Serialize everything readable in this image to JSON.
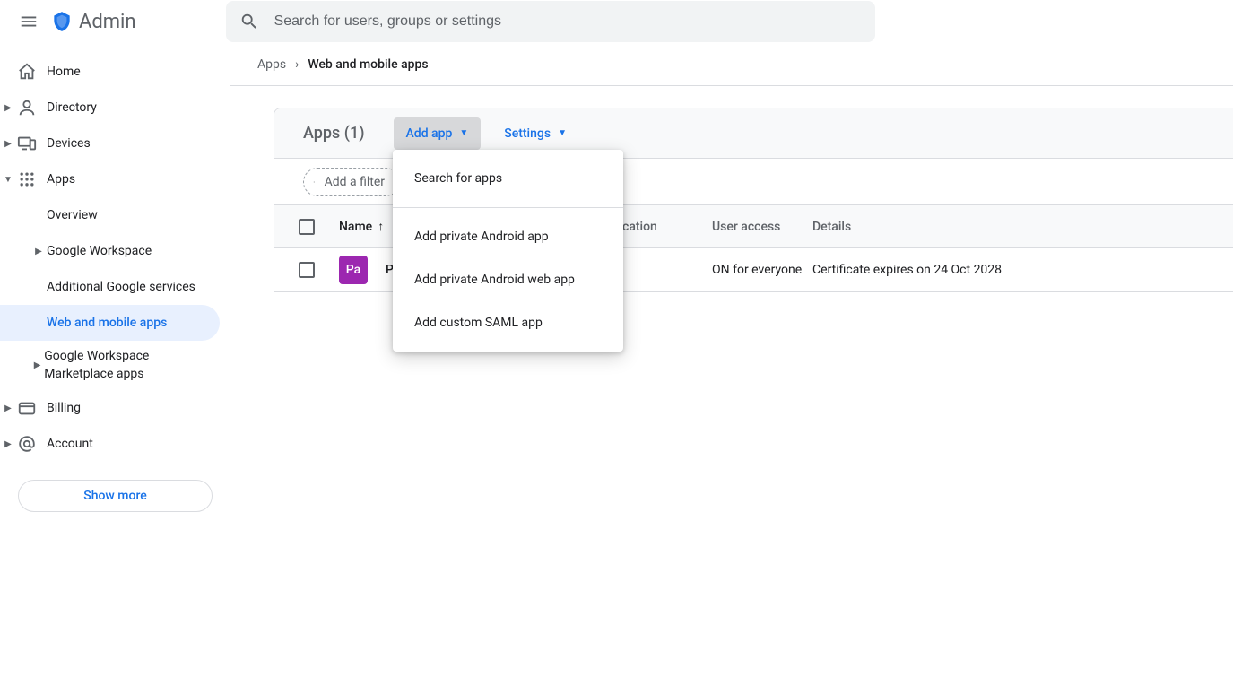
{
  "header": {
    "product": "Admin",
    "search_placeholder": "Search for users, groups or settings"
  },
  "sidebar": {
    "home": "Home",
    "directory": "Directory",
    "devices": "Devices",
    "apps": "Apps",
    "overview": "Overview",
    "google_workspace": "Google Workspace",
    "additional": "Additional Google services",
    "web_mobile": "Web and mobile apps",
    "marketplace": "Google Workspace Marketplace apps",
    "billing": "Billing",
    "account": "Account",
    "show_more": "Show more"
  },
  "breadcrumb": {
    "root": "Apps",
    "current": "Web and mobile apps"
  },
  "toolbar": {
    "title": "Apps (1)",
    "add_app": "Add app",
    "settings": "Settings",
    "filter": "Add a filter"
  },
  "table": {
    "cols": {
      "name": "Name",
      "auth": "ntication",
      "access": "User access",
      "details": "Details"
    },
    "row": {
      "icon_text": "Pa",
      "name": "P",
      "auth": "",
      "access": "ON for everyone",
      "details": "Certificate expires on 24 Oct 2028"
    }
  },
  "menu": {
    "search": "Search for apps",
    "android": "Add private Android app",
    "android_web": "Add private Android web app",
    "saml": "Add custom SAML app"
  }
}
